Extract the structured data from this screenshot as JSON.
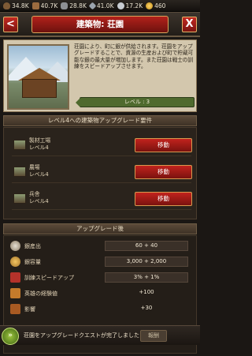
{
  "resources": {
    "food": "34.8K",
    "wood": "40.7K",
    "stone": "28.8K",
    "iron": "41.0K",
    "silver": "17.2K",
    "gold": "460"
  },
  "header": {
    "back_label": "<",
    "title": "建築物: 荘園",
    "close_label": "X"
  },
  "info": {
    "description": "荘園により、町に銀が供給されます。荘園をアップグレードすることで、資源の生産および町で貯蔵可能な銀の最大量が増加します。また荘園は戦士の訓練をスピードアップさせます。",
    "level_label": "レベル : 3"
  },
  "requirements": {
    "header": "レベル4への建築物アップグレード要件",
    "items": [
      {
        "name": "製材工場",
        "level": "レベル4",
        "button": "移動"
      },
      {
        "name": "農場",
        "level": "レベル4",
        "button": "移動"
      },
      {
        "name": "兵舎",
        "level": "レベル4",
        "button": "移動"
      }
    ]
  },
  "upgrade": {
    "header": "アップグレード後",
    "rows": [
      {
        "label": "銀産出",
        "value": "60 + 40"
      },
      {
        "label": "銀容量",
        "value": "3,000 + 2,000"
      },
      {
        "label": "訓練スピードアップ",
        "value": "3% + 1%"
      },
      {
        "label": "英雄の経験値",
        "value": "+100"
      },
      {
        "label": "影響",
        "value": "+30"
      }
    ]
  },
  "quest": {
    "text": "荘園をアップグレードクエストが完了しました!",
    "button": "報酬"
  },
  "colors": {
    "accent_red": "#b2211b",
    "level_green": "#4f6a2e",
    "quest_green": "#9cc43e"
  }
}
